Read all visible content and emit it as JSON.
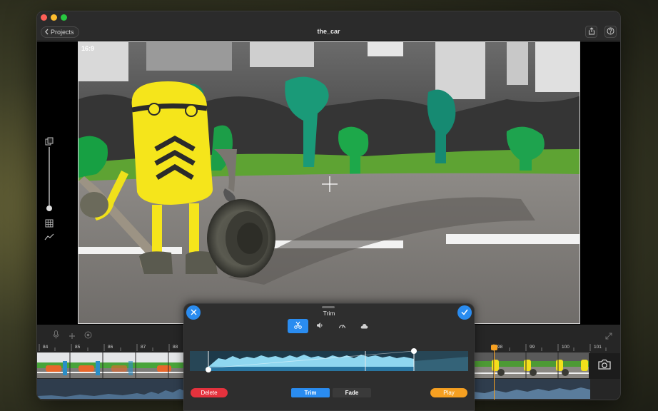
{
  "window": {
    "back_label": "Projects",
    "title": "the_car",
    "share_icon": "share-icon",
    "help_icon": "help-icon"
  },
  "viewer": {
    "aspect_label": "16:9",
    "crosshair_icon": "crosshair-icon"
  },
  "side_tools": {
    "icons": [
      "onion-skin-icon",
      "grid-icon",
      "graph-icon"
    ],
    "slider_level": 0.95
  },
  "timeline_toolbar": {
    "icons": [
      "microphone-icon",
      "add-icon",
      "capture-icon",
      "expand-icon"
    ]
  },
  "timeline": {
    "frame_numbers": [
      "84",
      "85",
      "86",
      "87",
      "88",
      "98",
      "99",
      "100",
      "101"
    ],
    "playhead_frame": "98",
    "camera_icon": "camera-icon"
  },
  "trim_panel": {
    "title": "Trim",
    "close_icon": "close-icon",
    "confirm_icon": "checkmark-icon",
    "tools": [
      {
        "name": "scissors-icon",
        "active": true
      },
      {
        "name": "volume-icon",
        "active": false
      },
      {
        "name": "speed-icon",
        "active": false
      },
      {
        "name": "cloud-icon",
        "active": false
      }
    ],
    "delete_label": "Delete",
    "trim_label": "Trim",
    "fade_label": "Fade",
    "play_label": "Play",
    "colors": {
      "accent": "#2a8cf0",
      "delete": "#e5323d",
      "play": "#f6a021",
      "waveform": "#8fd7f0"
    }
  }
}
